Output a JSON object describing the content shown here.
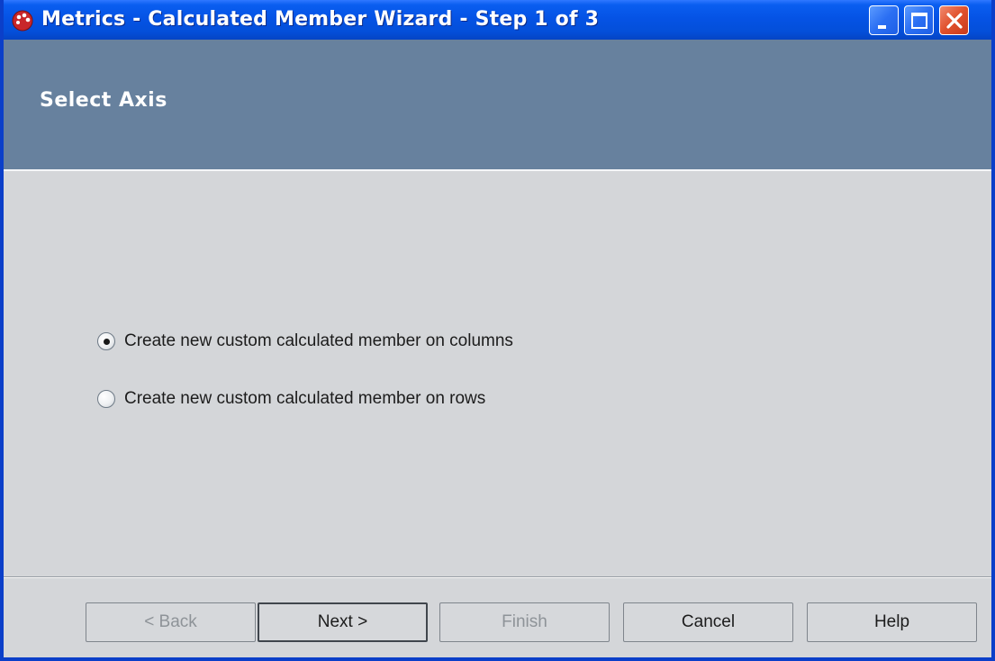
{
  "window": {
    "title": "Metrics - Calculated Member Wizard - Step 1 of 3",
    "icon": "app-icon",
    "controls": [
      "minimize-icon",
      "maximize-icon",
      "close-icon"
    ]
  },
  "header": {
    "title": "Select Axis"
  },
  "options": {
    "columns_label": "Create new custom calculated member on columns",
    "rows_label": "Create new custom calculated member on rows",
    "selected": "columns"
  },
  "buttons": {
    "back": "< Back",
    "next": "Next >",
    "finish": "Finish",
    "cancel": "Cancel",
    "help": "Help"
  },
  "colors": {
    "title_bar": "#0553e5",
    "header_band": "#67819e",
    "client_bg": "#d4d6d9",
    "close_button": "#e0502c"
  }
}
